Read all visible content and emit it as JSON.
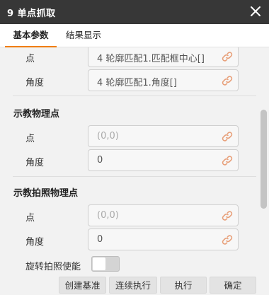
{
  "window": {
    "title": "9 单点抓取",
    "close_icon": "close-icon"
  },
  "tabs": [
    {
      "label": "基本参数",
      "active": true
    },
    {
      "label": "结果显示",
      "active": false
    }
  ],
  "sections": {
    "top": {
      "fields": [
        {
          "label": "点",
          "value": "4 轮廓匹配1.匹配框中心[]",
          "placeholder": false
        },
        {
          "label": "角度",
          "value": "4 轮廓匹配1.角度[]",
          "placeholder": false
        }
      ]
    },
    "teach_physical_point": {
      "title": "示教物理点",
      "fields": [
        {
          "label": "点",
          "value": "(0,0)",
          "placeholder": true
        },
        {
          "label": "角度",
          "value": "0",
          "placeholder": false
        }
      ]
    },
    "teach_photo_physical_point": {
      "title": "示教拍照物理点",
      "fields": [
        {
          "label": "点",
          "value": "(0,0)",
          "placeholder": true
        },
        {
          "label": "角度",
          "value": "0",
          "placeholder": false
        }
      ],
      "toggle": {
        "label": "旋转拍照使能",
        "on": false
      }
    }
  },
  "footer": {
    "buttons": [
      "创建基准",
      "连续执行",
      "执行",
      "确定"
    ]
  },
  "colors": {
    "titlebar": "#373737",
    "active_tab_underline": "#f07d00",
    "link_icon": "#e8a07a"
  }
}
